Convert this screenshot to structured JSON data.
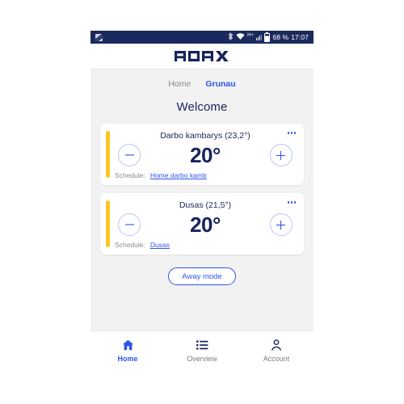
{
  "statusbar": {
    "app_icon": "app-notification-icon",
    "bluetooth_icon": "bluetooth-icon",
    "wifi_icon": "wifi-icon",
    "network_type": "H+",
    "signal_icon": "signal-bars-icon",
    "battery_icon": "battery-icon",
    "battery": "68 %",
    "time": "17:07"
  },
  "appbar": {
    "logo_text": "ADAX"
  },
  "tabs": [
    {
      "label": "Home",
      "active": false
    },
    {
      "label": "Grunau",
      "active": true
    }
  ],
  "page_title": "Welcome",
  "cards": [
    {
      "title": "Darbo kambarys (23,2°)",
      "temperature": "20°",
      "schedule_label": "Schedule:",
      "schedule_link": "Home darbo kamb",
      "accent_color": "#fdc521",
      "decrease_icon": "minus-circle-icon",
      "increase_icon": "plus-circle-icon",
      "menu_icon": "overflow-menu-icon"
    },
    {
      "title": "Dusas (21,5°)",
      "temperature": "20°",
      "schedule_label": "Schedule:",
      "schedule_link": "Dusas",
      "accent_color": "#fdc521",
      "decrease_icon": "minus-circle-icon",
      "increase_icon": "plus-circle-icon",
      "menu_icon": "overflow-menu-icon"
    }
  ],
  "away_button": "Away mode",
  "bottom_nav": [
    {
      "label": "Home",
      "icon": "home-icon",
      "active": true
    },
    {
      "label": "Overview",
      "icon": "list-icon",
      "active": false
    },
    {
      "label": "Account",
      "icon": "person-icon",
      "active": false
    }
  ],
  "colors": {
    "brand_navy": "#17235c",
    "accent_blue": "#2f55e8",
    "accent_yellow": "#fdc521",
    "statusbar": "#1b2a5e",
    "background": "#f2f2f2"
  }
}
